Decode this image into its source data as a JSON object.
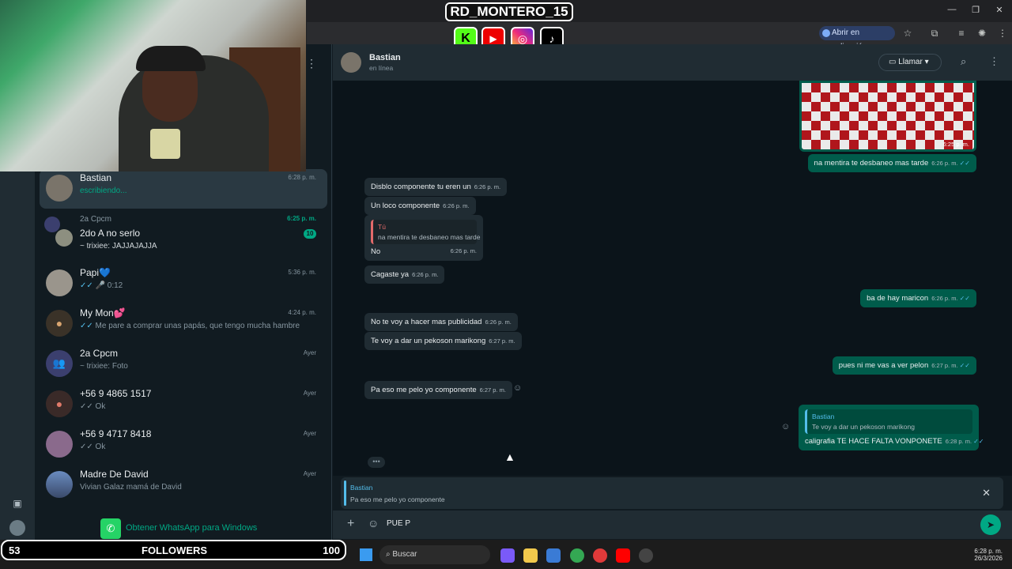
{
  "overlay": {
    "streamer_name": "RD_MONTERO_15",
    "followers_count_left": "53",
    "followers_label": "FOLLOWERS",
    "followers_count_right": "100",
    "socials": [
      "kick-icon",
      "youtube-icon",
      "instagram-icon",
      "tiktok-icon"
    ]
  },
  "browser": {
    "open_in_app_label": "Abrir en aplicación"
  },
  "sidebar": {
    "chats": [
      {
        "name": "Bastian",
        "subtitle": "escribiendo...",
        "time": "6:28 p. m.",
        "active": true
      },
      {
        "group": "2a Cpcm",
        "name": "2do A no serlo",
        "subtitle": "~ trixiee: JAJJAJAJJA",
        "time": "6:25 p. m.",
        "unread": "10"
      },
      {
        "name": "Papi💙",
        "subtitle": "0:12",
        "time": "5:36 p. m."
      },
      {
        "name": "My Mon💕",
        "subtitle": "Me pare a comprar unas papás, que tengo mucha hambre",
        "time": "4:24 p. m."
      },
      {
        "name": "2a Cpcm",
        "subtitle": "~ trixiee: Foto",
        "time": "Ayer"
      },
      {
        "name": "+56 9 4865 1517",
        "subtitle": "Ok",
        "time": "Ayer"
      },
      {
        "name": "+56 9 4717 8418",
        "subtitle": "Ok",
        "time": "Ayer"
      },
      {
        "name": "Madre De David",
        "subtitle": "Vivian Galaz mamá de David",
        "time": "Ayer"
      }
    ],
    "get_whatsapp_label": "Obtener WhatsApp para Windows"
  },
  "chat": {
    "contact_name": "Bastian",
    "contact_status": "en línea",
    "call_label": "Llamar",
    "messages": [
      {
        "dir": "out",
        "text": "na mentira te desbaneo mas tarde",
        "time": "6:26 p. m."
      },
      {
        "dir": "in",
        "text": "Disblo componente tu eren un",
        "time": "6:26 p. m."
      },
      {
        "dir": "in",
        "text": "Un loco componente",
        "time": "6:26 p. m."
      },
      {
        "dir": "in",
        "quote_author": "Tú",
        "quote_text": "na mentira te desbaneo mas tarde",
        "text": "No",
        "time": "6:26 p. m."
      },
      {
        "dir": "in",
        "text": "Cagaste ya",
        "time": "6:26 p. m."
      },
      {
        "dir": "out",
        "text": "ba de hay maricon",
        "time": "6:26 p. m."
      },
      {
        "dir": "in",
        "text": "No te voy a hacer mas publicidad",
        "time": "6:26 p. m."
      },
      {
        "dir": "in",
        "text": "Te voy a dar un pekoson marikong",
        "time": "6:27 p. m."
      },
      {
        "dir": "out",
        "text": "pues ni me vas a ver pelon",
        "time": "6:27 p. m."
      },
      {
        "dir": "in",
        "text": "Pa eso me pelo yo componente",
        "time": "6:27 p. m."
      },
      {
        "dir": "out",
        "quote_author": "Bastian",
        "quote_text": "Te voy a dar un pekoson marikong",
        "text": "caligrafia TE HACE FALTA VONPONETE",
        "time": "6:28 p. m."
      }
    ],
    "image_time": "6:25 p. m.",
    "reply_preview": {
      "author": "Bastian",
      "text": "Pa eso me pelo yo componente"
    },
    "composer_value": "PUE P"
  },
  "taskbar": {
    "search_label": "Buscar",
    "clock_time": "6:28 p. m.",
    "clock_date": "26/3/2026"
  },
  "colors": {
    "accent": "#00a884",
    "outgoing_bubble": "#005c4b",
    "incoming_bubble": "#202c33"
  }
}
